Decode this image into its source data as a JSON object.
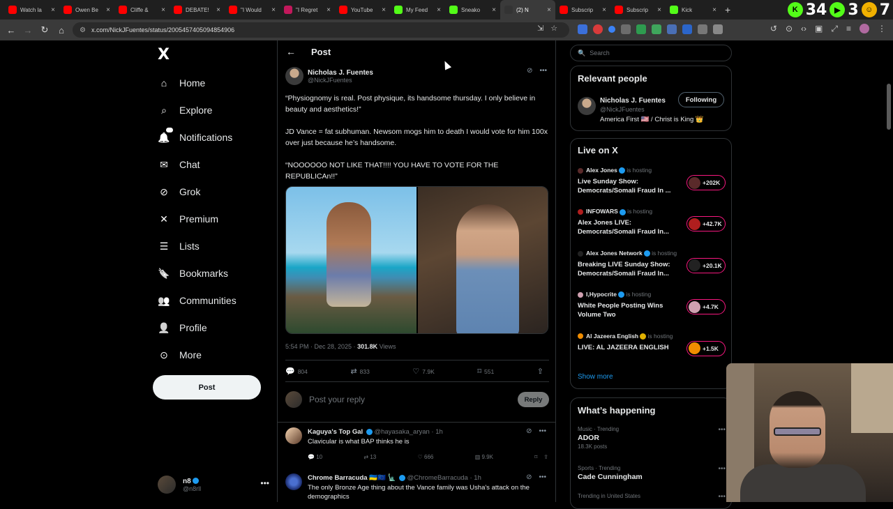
{
  "browser": {
    "tabs": [
      {
        "label": "Watch la",
        "color": "#ff0000",
        "active": false
      },
      {
        "label": "Owen Be",
        "color": "#ff0000",
        "active": false
      },
      {
        "label": "Cliffe &",
        "color": "#ff0000",
        "active": false
      },
      {
        "label": "DEBATE!",
        "color": "#ff0000",
        "active": false
      },
      {
        "label": "\"I Would",
        "color": "#ff0000",
        "active": false
      },
      {
        "label": "\"I Regret",
        "color": "#c2185b",
        "active": false
      },
      {
        "label": "YouTube",
        "color": "#ff0000",
        "active": false
      },
      {
        "label": "My Feed",
        "color": "#53fc18",
        "active": false
      },
      {
        "label": "Sneako",
        "color": "#53fc18",
        "active": false
      },
      {
        "label": "(2) N",
        "color": "#333333",
        "active": true
      },
      {
        "label": "Subscrip",
        "color": "#ff0000",
        "active": false
      },
      {
        "label": "Subscrip",
        "color": "#ff0000",
        "active": false
      },
      {
        "label": "Kick",
        "color": "#53fc18",
        "active": false
      }
    ],
    "tab_counts": [
      "34",
      "3",
      "7"
    ],
    "url": "x.com/NickJFuentes/status/2005457405094854906"
  },
  "nav": {
    "logo": "X",
    "items": [
      {
        "label": "Home",
        "icon": "home-icon"
      },
      {
        "label": "Explore",
        "icon": "search-icon"
      },
      {
        "label": "Notifications",
        "icon": "bell-icon",
        "badge": "2"
      },
      {
        "label": "Chat",
        "icon": "mail-icon"
      },
      {
        "label": "Grok",
        "icon": "grok-icon"
      },
      {
        "label": "Premium",
        "icon": "x-icon"
      },
      {
        "label": "Lists",
        "icon": "list-icon"
      },
      {
        "label": "Bookmarks",
        "icon": "bookmark-icon"
      },
      {
        "label": "Communities",
        "icon": "people-icon"
      },
      {
        "label": "Profile",
        "icon": "person-icon"
      },
      {
        "label": "More",
        "icon": "more-circle-icon"
      }
    ],
    "post_label": "Post",
    "account": {
      "name": "n8",
      "handle": "@n8rll"
    }
  },
  "post": {
    "header_title": "Post",
    "author": {
      "name": "Nicholas J. Fuentes",
      "handle": "@NickJFuentes"
    },
    "paragraphs": [
      "“Physiognomy is real. Post physique, its handsome thursday. I only believe in beauty and aesthetics!”",
      "JD Vance = fat subhuman. Newsom mogs him to death I would vote for him 100x over just because he’s handsome.",
      "“NOOOOOO NOT LIKE THAT!!!! YOU HAVE TO VOTE FOR THE REPUBLICAn!!”"
    ],
    "time": "5:54 PM · Dec 28, 2025 · ",
    "views": "301.8K",
    "views_label": " Views",
    "stats": {
      "replies": "804",
      "reposts": "833",
      "likes": "7.9K",
      "bookmarks": "551"
    },
    "reply_placeholder": "Post your reply",
    "reply_button": "Reply"
  },
  "replies": [
    {
      "name": "Kaguya's Top Gal",
      "handle": "@hayasaka_aryan · 1h",
      "text": "Clavicular is what BAP thinks he is",
      "replies": "10",
      "reposts": "13",
      "likes": "666",
      "views": "9.9K"
    },
    {
      "name": "Chrome Barracuda 🇺🇦🇪🇺 🗽",
      "handle": "@ChromeBarracuda · 1h",
      "text": "The only Bronze Age thing about the Vance family was Usha's attack on the demographics"
    }
  ],
  "sidebar": {
    "search_placeholder": "Search",
    "relevant_title": "Relevant people",
    "relevant": {
      "name": "Nicholas J. Fuentes",
      "handle": "@NickJFuentes",
      "bio": "America First 🇺🇸 / Christ is King 👑",
      "follow_label": "Following"
    },
    "live_title": "Live on X",
    "live": [
      {
        "host": "Alex Jones",
        "status": " is hosting",
        "title": "Live Sunday Show: Democrats/Somali Fraud In ...",
        "count": "+202K"
      },
      {
        "host": "INFOWARS",
        "status": " is hosting",
        "title": "Alex Jones LIVE: Democrats/Somali Fraud In...",
        "count": "+42.7K"
      },
      {
        "host": "Alex Jones Network",
        "status": " is hosting",
        "title": "Breaking LIVE Sunday Show: Democrats/Somali Fraud In...",
        "count": "+20.1K"
      },
      {
        "host": "I,Hypocrite",
        "status": " is hosting",
        "title": "White People Posting Wins Volume Two",
        "count": "+4.7K"
      },
      {
        "host": "Al Jazeera English",
        "status": " is hosting",
        "title": "LIVE: AL JAZEERA ENGLISH",
        "count": "+1.5K"
      }
    ],
    "show_more": "Show more",
    "happening_title": "What’s happening",
    "trends": [
      {
        "category": "Music · Trending",
        "name": "ADOR",
        "count": "18.3K posts"
      },
      {
        "category": "Sports · Trending",
        "name": "Cade Cunningham",
        "count": ""
      },
      {
        "category": "Trending in United States",
        "name": "",
        "count": ""
      }
    ]
  }
}
